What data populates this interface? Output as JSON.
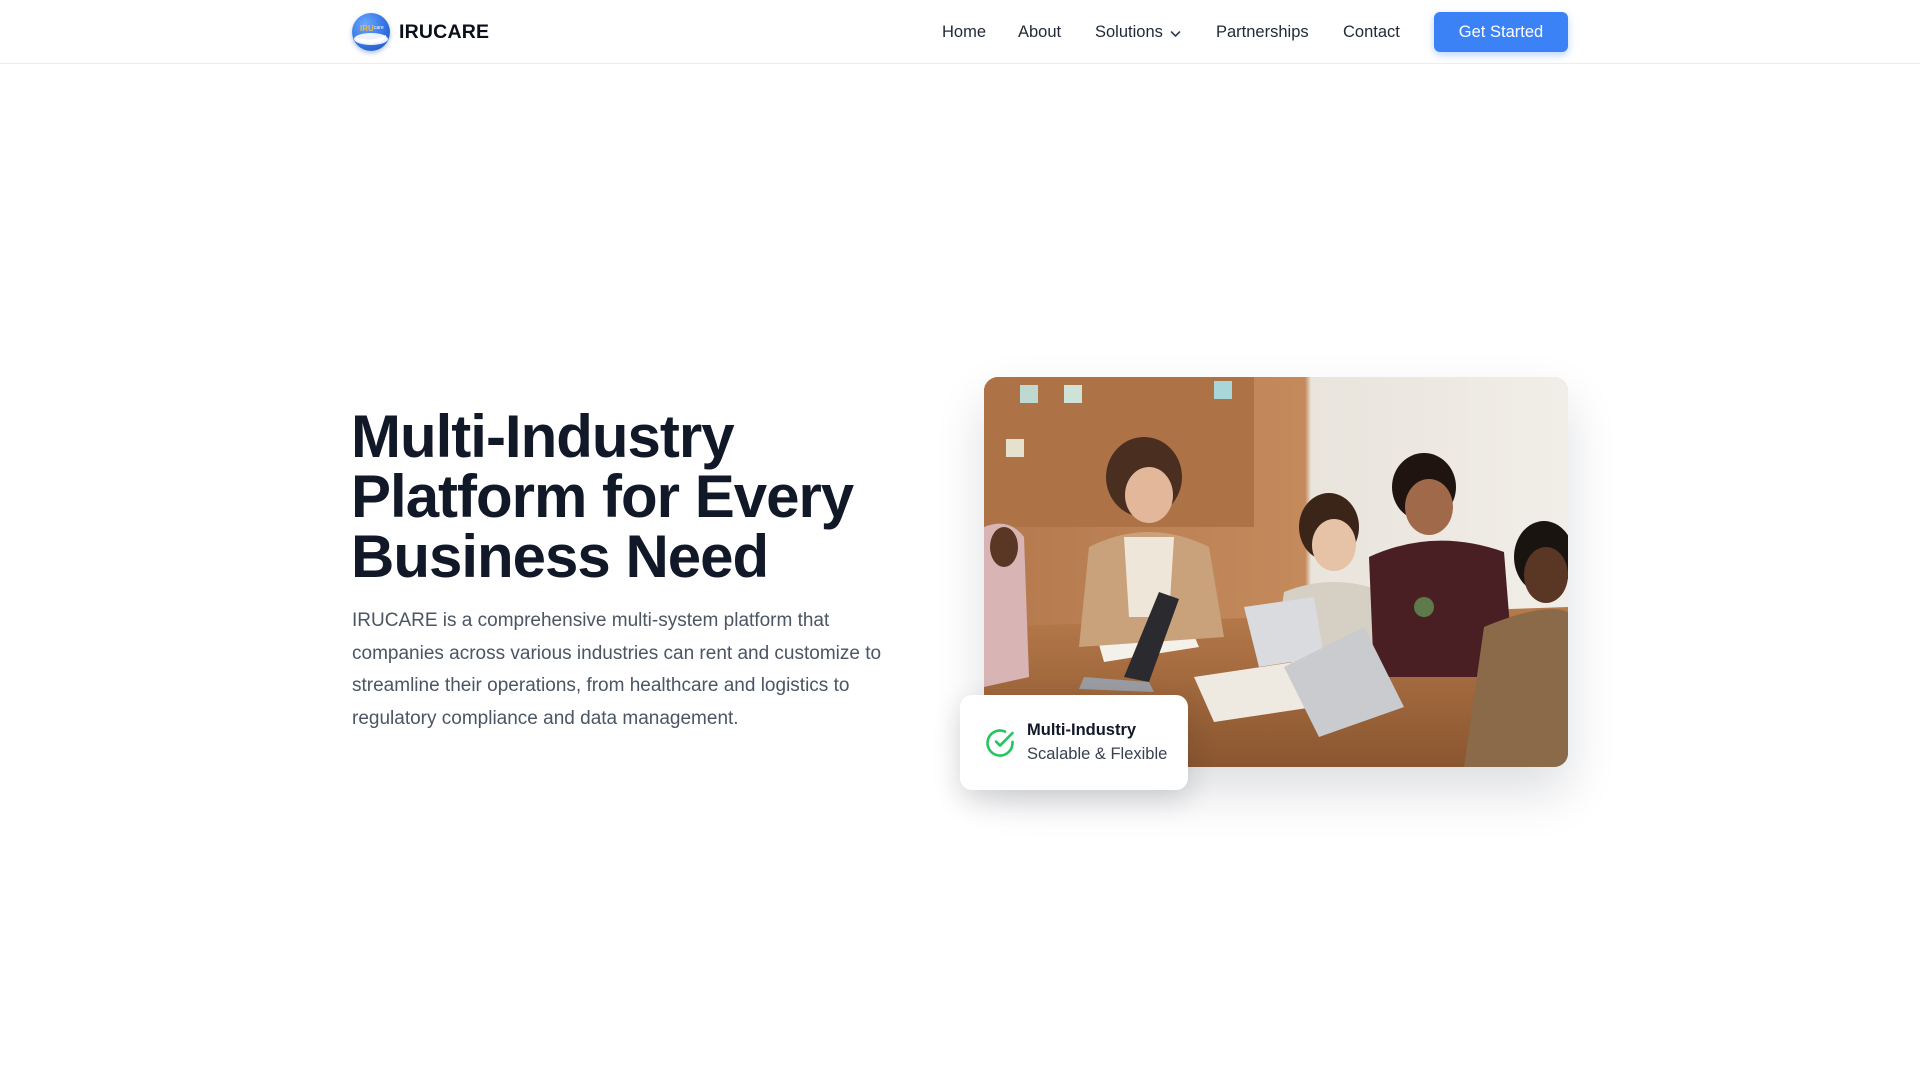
{
  "brand": {
    "name": "IRUCARE",
    "logo_icon": "globe-logo-icon"
  },
  "nav": {
    "items": [
      {
        "label": "Home"
      },
      {
        "label": "About"
      },
      {
        "label": "Solutions",
        "icon": "chevron-down-icon"
      },
      {
        "label": "Partnerships"
      },
      {
        "label": "Contact"
      }
    ],
    "cta_label": "Get Started"
  },
  "hero": {
    "title": "Multi-Industry Platform for Every Business Need",
    "description": "IRUCARE is a comprehensive multi-system platform that companies across various industries can rent and customize to streamline their operations, from healthcare and logistics to regulatory compliance and data management.",
    "image_alt": "team collaborating around a table",
    "badge": {
      "icon": "check-circle-icon",
      "title": "Multi-Industry",
      "subtitle": "Scalable & Flexible"
    }
  },
  "colors": {
    "accent": "#3b82f6",
    "heading": "#111827",
    "body_text": "#4b5563",
    "check_green": "#22c55e"
  }
}
